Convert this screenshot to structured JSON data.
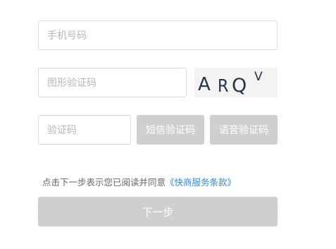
{
  "form": {
    "phone_placeholder": "手机号码",
    "captcha_placeholder": "图形验证码",
    "captcha_chars": [
      "A",
      "R",
      "Q",
      "V"
    ],
    "code_placeholder": "验证码",
    "sms_button_label": "短信验证码",
    "voice_button_label": "语音验证码",
    "agreement_prefix": "点击下一步表示您已阅读并同意",
    "agreement_link": "《快商服务条款》",
    "next_button_label": "下一步"
  },
  "colors": {
    "border": "#d9d9d9",
    "placeholder": "#b7b7b7",
    "disabled_button": "#cfcfcf",
    "link": "#2b8ad8",
    "captcha_text": "#26344b"
  }
}
